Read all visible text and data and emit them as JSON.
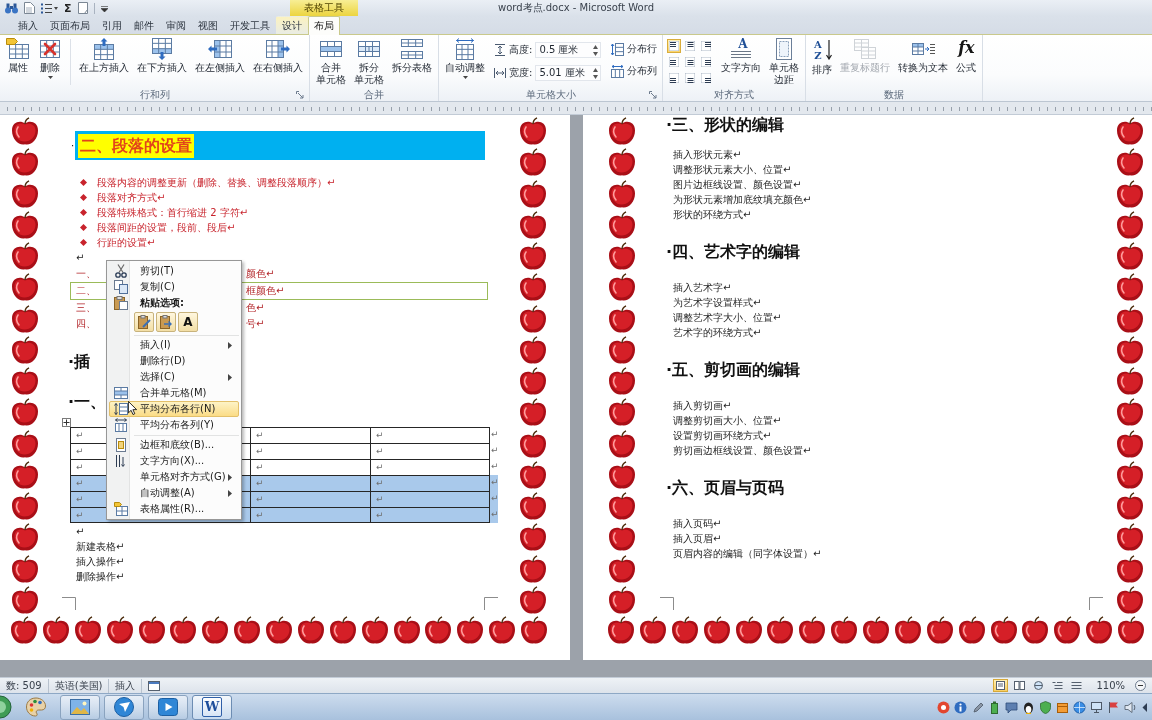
{
  "quick_access": [
    {
      "kind": "find"
    },
    {
      "kind": "document"
    },
    {
      "kind": "list"
    },
    {
      "kind": "sum",
      "glyph": "Σ"
    },
    {
      "kind": "page"
    },
    {
      "kind": "customize"
    }
  ],
  "contextual_group": {
    "label": "表格工具"
  },
  "window": {
    "title": "word考点.docx - Microsoft Word"
  },
  "tabs": [
    {
      "label": "插入",
      "selected": false,
      "contextual": false
    },
    {
      "label": "页面布局",
      "selected": false,
      "contextual": false
    },
    {
      "label": "引用",
      "selected": false,
      "contextual": false
    },
    {
      "label": "邮件",
      "selected": false,
      "contextual": false
    },
    {
      "label": "审阅",
      "selected": false,
      "contextual": false
    },
    {
      "label": "视图",
      "selected": false,
      "contextual": false
    },
    {
      "label": "开发工具",
      "selected": false,
      "contextual": false
    },
    {
      "label": "设计",
      "selected": false,
      "contextual": true
    },
    {
      "label": "布局",
      "selected": true,
      "contextual": true
    }
  ],
  "ribbon": {
    "groups": [
      {
        "label": "行和列",
        "launcher": true,
        "controls": [
          {
            "kind": "properties",
            "lines": [
              "属性"
            ],
            "dropdown": false,
            "disabled": false
          },
          {
            "kind": "delete",
            "lines": [
              "删除"
            ],
            "dropdown": true,
            "disabled": false
          },
          {
            "kind": "separator"
          },
          {
            "kind": "insert_above",
            "lines": [
              "在上方插入"
            ],
            "dropdown": false,
            "disabled": false
          },
          {
            "kind": "insert_below",
            "lines": [
              "在下方插入"
            ],
            "dropdown": false,
            "disabled": false
          },
          {
            "kind": "insert_left",
            "lines": [
              "在左侧插入"
            ],
            "dropdown": false,
            "disabled": false
          },
          {
            "kind": "insert_right",
            "lines": [
              "在右侧插入"
            ],
            "dropdown": false,
            "disabled": false
          }
        ]
      },
      {
        "label": "合并",
        "launcher": false,
        "controls": [
          {
            "kind": "merge",
            "lines": [
              "合并",
              "单元格"
            ],
            "dropdown": false,
            "disabled": false
          },
          {
            "kind": "split_cells",
            "lines": [
              "拆分",
              "单元格"
            ],
            "dropdown": false,
            "disabled": false
          },
          {
            "kind": "split_table",
            "lines": [
              "拆分表格"
            ],
            "dropdown": false,
            "disabled": false
          }
        ]
      },
      {
        "label": "单元格大小",
        "launcher": true,
        "controls": [
          {
            "kind": "autofit",
            "lines": [
              "自动调整"
            ],
            "dropdown": true,
            "disabled": false
          },
          {
            "kind": "size_fields",
            "fields": [
              {
                "kind": "height",
                "label": "高度:",
                "value": "0.5 厘米"
              },
              {
                "kind": "width",
                "label": "宽度:",
                "value": "5.01 厘米"
              }
            ]
          },
          {
            "kind": "small_buttons",
            "buttons": [
              {
                "kind": "distribute_rows",
                "label": "分布行"
              },
              {
                "kind": "distribute_columns",
                "label": "分布列"
              }
            ]
          }
        ]
      },
      {
        "label": "对齐方式",
        "launcher": false,
        "controls": [
          {
            "kind": "alignment_grid",
            "cells": [
              {
                "selected": true
              },
              {
                "selected": false
              },
              {
                "selected": false
              },
              {
                "selected": false
              },
              {
                "selected": false
              },
              {
                "selected": false
              },
              {
                "selected": false
              },
              {
                "selected": false
              },
              {
                "selected": false
              }
            ]
          },
          {
            "kind": "text_direction",
            "glyph": "A",
            "lines": [
              "文字方向"
            ],
            "dropdown": false,
            "disabled": false
          },
          {
            "kind": "cell_margins",
            "lines": [
              "单元格",
              "边距"
            ],
            "dropdown": false,
            "disabled": false
          }
        ]
      },
      {
        "label": "数据",
        "launcher": false,
        "controls": [
          {
            "kind": "sort",
            "glyph": "AZ",
            "lines": [
              "排序"
            ],
            "dropdown": false,
            "disabled": false
          },
          {
            "kind": "repeat_header",
            "lines": [
              "重复标题行"
            ],
            "dropdown": false,
            "disabled": true
          },
          {
            "kind": "convert",
            "lines": [
              "转换为文本"
            ],
            "dropdown": false,
            "disabled": false
          },
          {
            "kind": "formula",
            "glyph": "fx",
            "lines": [
              "公式"
            ],
            "dropdown": false,
            "disabled": false
          }
        ]
      }
    ]
  },
  "document": {
    "pages": [
      {
        "blocks": [
          {
            "kind": "banner",
            "mark": "·",
            "text": "二、段落的设置"
          },
          {
            "kind": "bullets",
            "items": [
              "段落内容的调整更新（删除、替换、调整段落顺序）↵",
              "段落对齐方式↵",
              "段落特殊格式：首行缩进 2 字符↵",
              "段落间距的设置，段前、段后↵",
              "行距的设置↵"
            ]
          },
          {
            "kind": "paragraph",
            "text": "↵"
          },
          {
            "kind": "split_lines",
            "lines": [
              {
                "lead": "一、",
                "tail": "颜色↵",
                "boxed": false
              },
              {
                "lead": "二、",
                "tail": "框颜色↵",
                "boxed": true
              },
              {
                "lead": "三、",
                "tail": "色↵",
                "boxed": false
              },
              {
                "lead": "四、",
                "tail": "号↵",
                "boxed": false
              }
            ]
          },
          {
            "kind": "heading",
            "text": "·插"
          },
          {
            "kind": "heading",
            "text": "·一、"
          },
          {
            "kind": "table",
            "rows": [
              {
                "selected": false,
                "cells": [
                  "↵",
                  "↵",
                  "↵"
                ],
                "end": "↵"
              },
              {
                "selected": false,
                "cells": [
                  "↵",
                  "↵",
                  "↵"
                ],
                "end": "↵"
              },
              {
                "selected": false,
                "cells": [
                  "↵",
                  "↵",
                  "↵"
                ],
                "end": "↵"
              },
              {
                "selected": true,
                "cells": [
                  "↵",
                  "↵",
                  "↵"
                ],
                "end": "↵"
              },
              {
                "selected": true,
                "cells": [
                  "↵",
                  "↵",
                  "↵"
                ],
                "end": "↵"
              },
              {
                "selected": true,
                "cells": [
                  "↵",
                  "↵",
                  "↵"
                ],
                "end": "↵"
              }
            ]
          },
          {
            "kind": "paragraphs",
            "items": [
              "↵",
              "新建表格↵",
              "插入操作↵",
              "删除操作↵"
            ]
          }
        ]
      },
      {
        "blocks": [
          {
            "kind": "heading",
            "text": "·三、形状的编辑"
          },
          {
            "kind": "list",
            "items": [
              "插入形状元素↵",
              "调整形状元素大小、位置↵",
              "图片边框线设置、颜色设置↵",
              "为形状元素增加底纹填充颜色↵",
              "形状的环绕方式↵"
            ]
          },
          {
            "kind": "heading",
            "text": "·四、艺术字的编辑"
          },
          {
            "kind": "list",
            "items": [
              "插入艺术字↵",
              "为艺术字设置样式↵",
              "调整艺术字大小、位置↵",
              "艺术字的环绕方式↵"
            ]
          },
          {
            "kind": "heading",
            "text": "·五、剪切画的编辑"
          },
          {
            "kind": "list",
            "items": [
              "插入剪切画↵",
              "调整剪切画大小、位置↵",
              "设置剪切画环绕方式↵",
              "剪切画边框线设置、颜色设置↵"
            ]
          },
          {
            "kind": "heading",
            "text": "·六、页眉与页码"
          },
          {
            "kind": "list",
            "items": [
              "插入页码↵",
              "插入页眉↵",
              "页眉内容的编辑（同字体设置）↵"
            ]
          }
        ]
      }
    ]
  },
  "context_menu": {
    "items": [
      {
        "kind": "cut",
        "label": "剪切(T)",
        "submenu": false,
        "selected": false
      },
      {
        "kind": "copy",
        "label": "复制(C)",
        "submenu": false,
        "selected": false
      },
      {
        "kind": "paste_header",
        "label": "粘贴选项:"
      },
      {
        "kind": "paste_options",
        "options": [
          {
            "kind": "keep_source"
          },
          {
            "kind": "merge"
          },
          {
            "kind": "text_only",
            "glyph": "A"
          }
        ]
      },
      {
        "kind": "separator"
      },
      {
        "kind": "plain",
        "label": "插入(I)",
        "submenu": true,
        "selected": false
      },
      {
        "kind": "plain",
        "label": "删除行(D)",
        "submenu": false,
        "selected": false
      },
      {
        "kind": "plain",
        "label": "选择(C)",
        "submenu": true,
        "selected": false
      },
      {
        "kind": "merge",
        "label": "合并单元格(M)",
        "submenu": false,
        "selected": false
      },
      {
        "kind": "distribute_rows",
        "label": "平均分布各行(N)",
        "submenu": false,
        "selected": true
      },
      {
        "kind": "distribute_columns",
        "label": "平均分布各列(Y)",
        "submenu": false,
        "selected": false
      },
      {
        "kind": "separator"
      },
      {
        "kind": "borders",
        "label": "边框和底纹(B)...",
        "submenu": false,
        "selected": false
      },
      {
        "kind": "text_direction",
        "label": "文字方向(X)...",
        "submenu": false,
        "selected": false
      },
      {
        "kind": "plain",
        "label": "单元格对齐方式(G)",
        "submenu": true,
        "selected": false
      },
      {
        "kind": "plain",
        "label": "自动调整(A)",
        "submenu": true,
        "selected": false
      },
      {
        "kind": "table_properties",
        "label": "表格属性(R)...",
        "submenu": false,
        "selected": false
      }
    ]
  },
  "status_bar": {
    "items": [
      "数: 509",
      "英语(美国)",
      "插入"
    ],
    "views": [
      {
        "selected": true
      },
      {
        "selected": false
      },
      {
        "selected": false
      },
      {
        "selected": false
      },
      {
        "selected": false
      }
    ],
    "zoom": "110%"
  },
  "taskbar": {
    "apps": [
      {
        "kind": "paint",
        "running": false,
        "active": false
      },
      {
        "kind": "image",
        "running": true,
        "active": false
      },
      {
        "kind": "round",
        "running": true,
        "active": false
      },
      {
        "kind": "video",
        "running": true,
        "active": false
      },
      {
        "kind": "word",
        "glyph": "W",
        "running": true,
        "active": true
      }
    ]
  }
}
